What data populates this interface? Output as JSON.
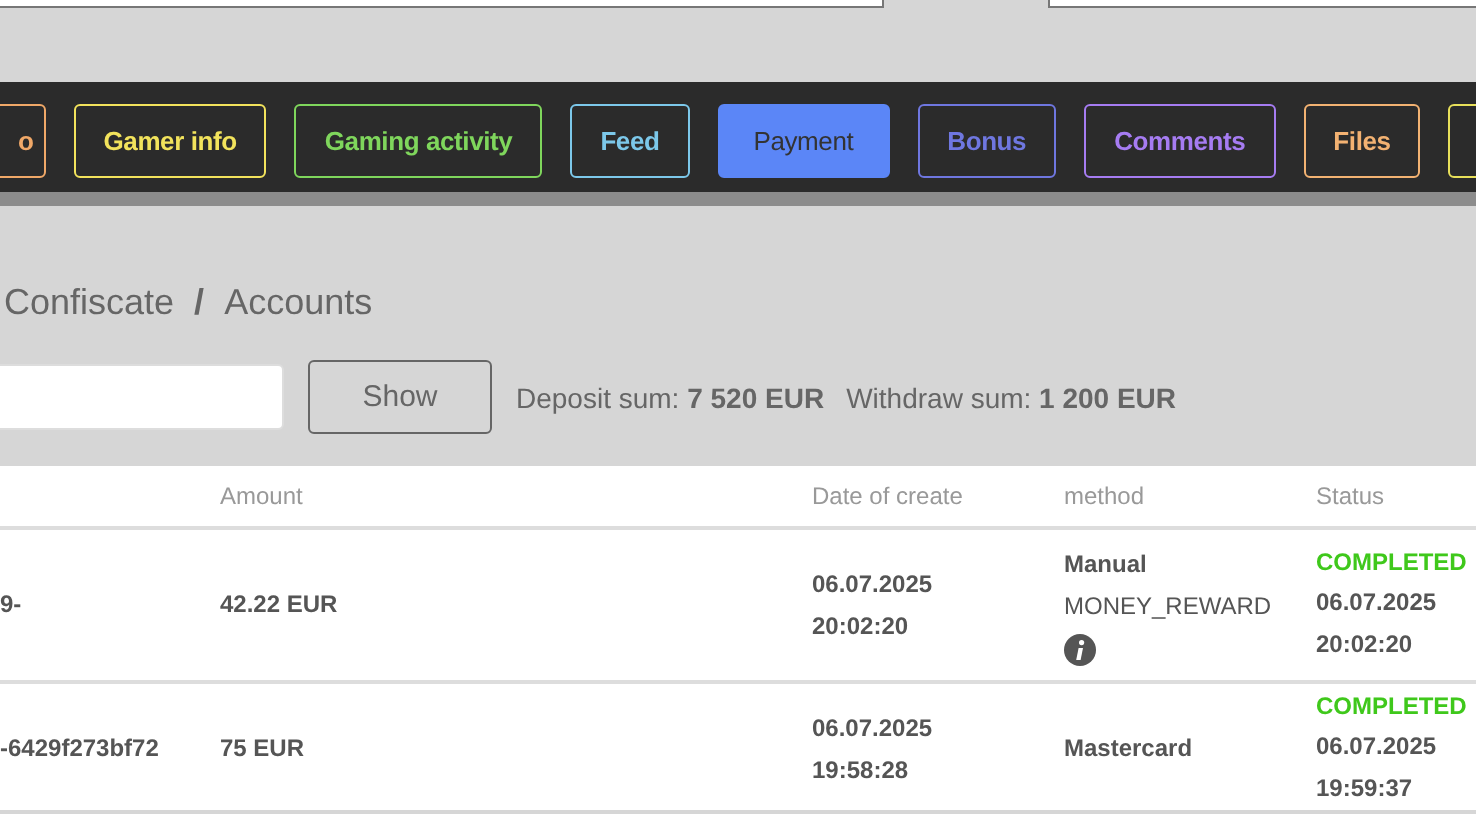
{
  "tabs": [
    {
      "label": "o",
      "color": "#f0a868",
      "selected": false
    },
    {
      "label": "Gamer info",
      "color": "#f2e35c",
      "selected": false
    },
    {
      "label": "Gaming activity",
      "color": "#7fd65c",
      "selected": false
    },
    {
      "label": "Feed",
      "color": "#7cc8ea",
      "selected": false
    },
    {
      "label": "Payment",
      "color": "#5b86f7",
      "selected": true
    },
    {
      "label": "Bonus",
      "color": "#6f77e0",
      "selected": false
    },
    {
      "label": "Comments",
      "color": "#a67cf2",
      "selected": false
    },
    {
      "label": "Files",
      "color": "#f3b272",
      "selected": false
    },
    {
      "color": "#e8e05a",
      "selected": false
    }
  ],
  "breadcrumb": {
    "items": [
      "Confiscate",
      "Accounts"
    ],
    "separator": "/"
  },
  "filter": {
    "button": "Show",
    "sums": [
      {
        "label": "Deposit sum:",
        "value": "7 520 EUR"
      },
      {
        "label": "Withdraw sum:",
        "value": "1 200 EUR"
      }
    ]
  },
  "table": {
    "columns": [
      "Amount",
      "Date of create",
      "method",
      "Status"
    ],
    "rows": [
      {
        "column_1": "9-",
        "amount": "42.22 EUR",
        "date": "06.07.2025",
        "time": "20:02:20",
        "method": "Manual",
        "method_detail": "MONEY_REWARD",
        "info": true,
        "status": "COMPLETED",
        "status_date": "06.07.2025",
        "status_time": "20:02:20"
      },
      {
        "column_1": "-6429f273bf72",
        "amount": "75 EUR",
        "date": "06.07.2025",
        "time": "19:58:28",
        "method": "Mastercard",
        "info": false,
        "status": "COMPLETED",
        "status_date": "06.07.2025",
        "status_time": "19:59:37"
      }
    ]
  }
}
